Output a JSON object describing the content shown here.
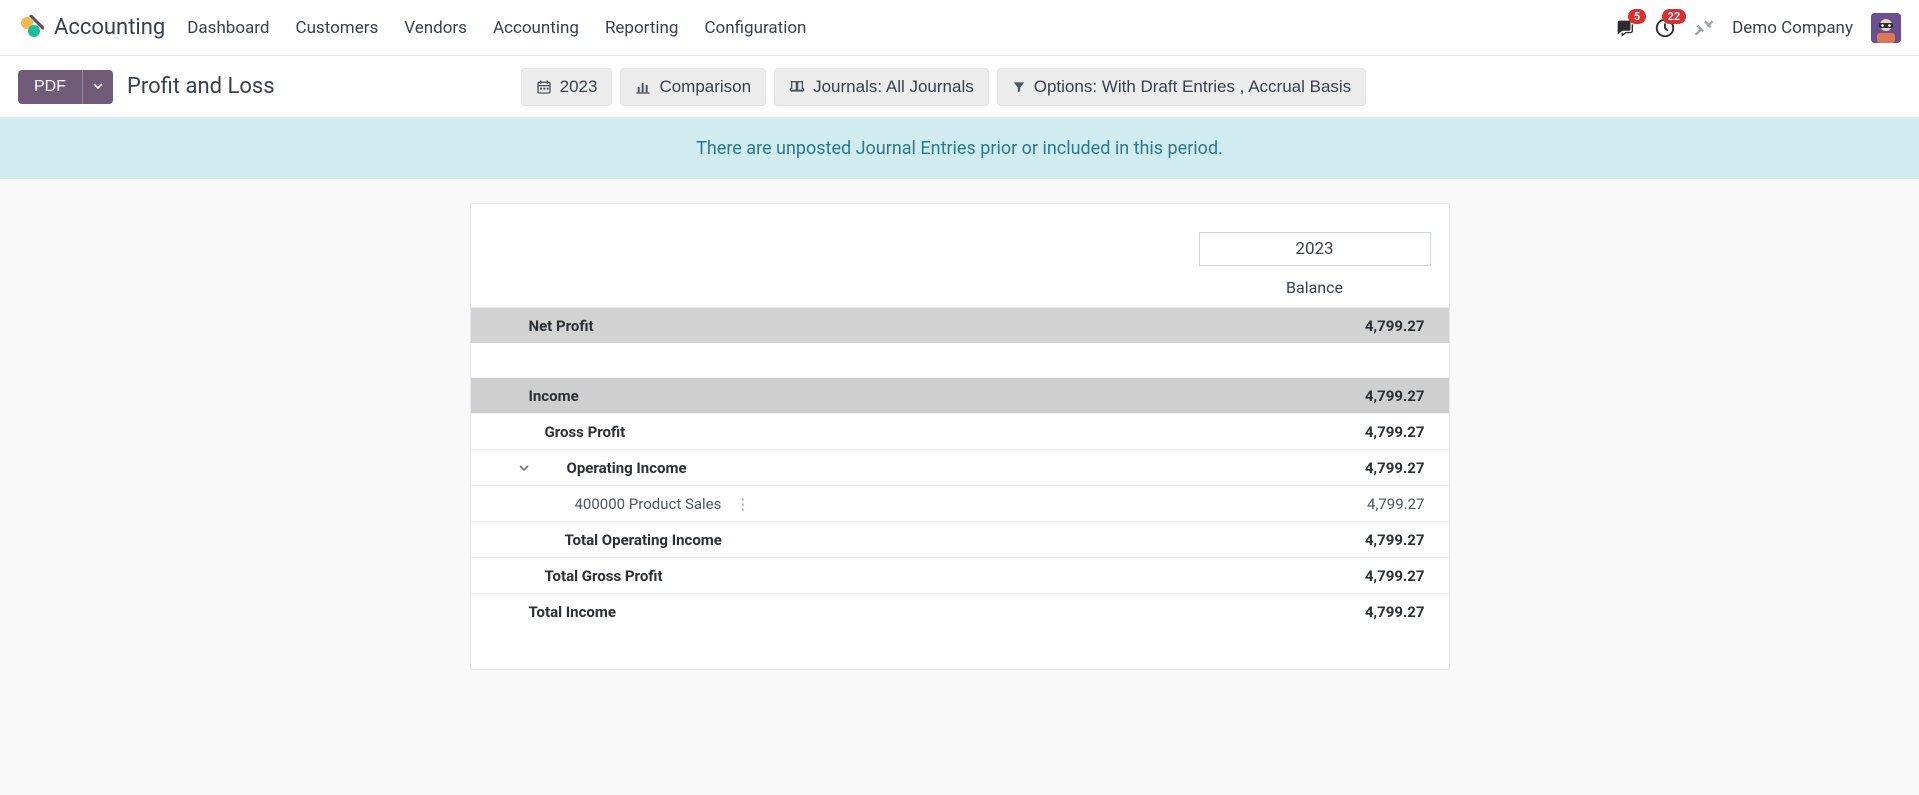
{
  "header": {
    "app_name": "Accounting",
    "menu": [
      "Dashboard",
      "Customers",
      "Vendors",
      "Accounting",
      "Reporting",
      "Configuration"
    ],
    "messages_badge": "5",
    "activities_badge": "22",
    "company": "Demo Company"
  },
  "controls": {
    "pdf_label": "PDF",
    "report_title": "Profit and Loss",
    "period": "2023",
    "comparison": "Comparison",
    "journals": "Journals: All Journals",
    "options": "Options: With Draft Entries , Accrual Basis"
  },
  "alert": "There are unposted Journal Entries prior or included in this period.",
  "report": {
    "year": "2023",
    "balance_label": "Balance",
    "rows": {
      "net_profit": {
        "label": "Net Profit",
        "amount": "4,799.27"
      },
      "income": {
        "label": "Income",
        "amount": "4,799.27"
      },
      "gross_profit": {
        "label": "Gross Profit",
        "amount": "4,799.27"
      },
      "operating_income": {
        "label": "Operating Income",
        "amount": "4,799.27"
      },
      "product_sales": {
        "label": "400000 Product Sales",
        "amount": "4,799.27"
      },
      "total_operating_income": {
        "label": "Total Operating Income",
        "amount": "4,799.27"
      },
      "total_gross_profit": {
        "label": "Total Gross Profit",
        "amount": "4,799.27"
      },
      "total_income": {
        "label": "Total Income",
        "amount": "4,799.27"
      }
    }
  }
}
